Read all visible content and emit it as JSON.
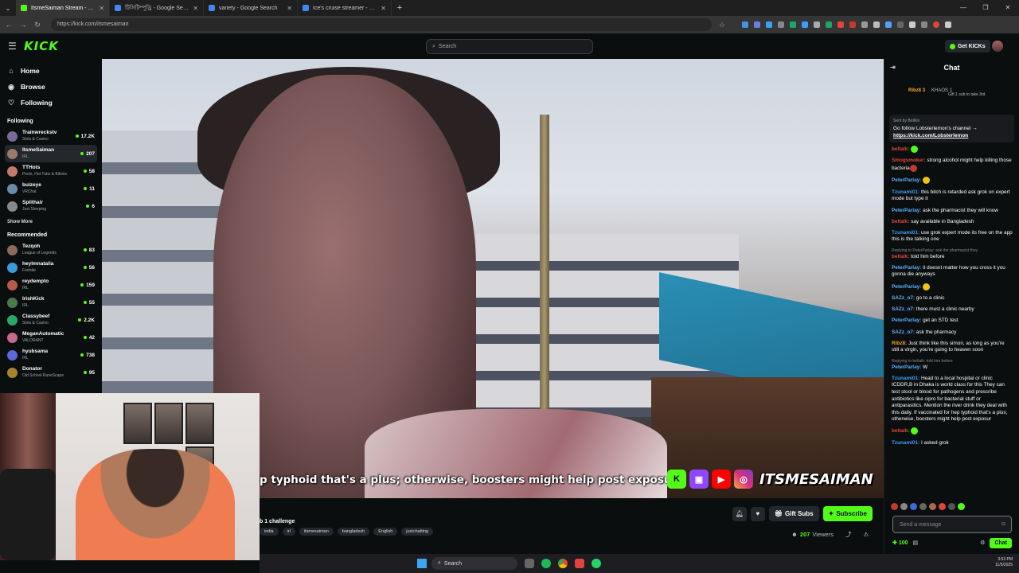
{
  "browser": {
    "tabs": [
      {
        "label": "ItsmeSaiman Stream - Wat",
        "color": "#53fc18",
        "active": true
      },
      {
        "label": "টিসিটিম্পুড্রি - Google Search",
        "color": "#4285f4",
        "active": false
      },
      {
        "label": "variety - Google Search",
        "color": "#4285f4",
        "active": false
      },
      {
        "label": "Ice's cruise streamer - Google S",
        "color": "#4285f4",
        "active": false
      }
    ],
    "url": "https://kick.com/itsmesaiman"
  },
  "header": {
    "logo": "KICK",
    "search_placeholder": "Search",
    "get_kicks": "Get KICKs"
  },
  "sidebar": {
    "nav": [
      {
        "label": "Home",
        "icon": "home-icon",
        "glyph": "⌂"
      },
      {
        "label": "Browse",
        "icon": "browse-icon",
        "glyph": "◉"
      },
      {
        "label": "Following",
        "icon": "heart-icon",
        "glyph": "♡"
      }
    ],
    "following_title": "Following",
    "following": [
      {
        "name": "Trainwreckstv",
        "cat": "Slots & Casino",
        "viewers": "17.2K",
        "color": "#7a6a9a"
      },
      {
        "name": "ItsmeSaiman",
        "cat": "IRL",
        "viewers": "207",
        "color": "#9a7a6a"
      },
      {
        "name": "TTHots",
        "cat": "Pools, Hot Tubs & Bikinis",
        "viewers": "58",
        "color": "#c47a6a"
      },
      {
        "name": "buizeye",
        "cat": "VRChat",
        "viewers": "11",
        "color": "#6a8aa9"
      },
      {
        "name": "Splithair",
        "cat": "Just Sleeping",
        "viewers": "6",
        "color": "#888"
      }
    ],
    "show_more": "Show More",
    "recommended_title": "Recommended",
    "recommended": [
      {
        "name": "Tezqoh",
        "cat": "League of Legends",
        "viewers": "83",
        "color": "#8a6a5a"
      },
      {
        "name": "heylmnatalia",
        "cat": "Fortnite",
        "viewers": "56",
        "color": "#3a9adb"
      },
      {
        "name": "reydempto",
        "cat": "IRL",
        "viewers": "159",
        "color": "#b85a4a"
      },
      {
        "name": "IrishKick",
        "cat": "IRL",
        "viewers": "55",
        "color": "#4a7a4a"
      },
      {
        "name": "Classybeef",
        "cat": "Slots & Casino",
        "viewers": "2.2K",
        "color": "#2aa86a"
      },
      {
        "name": "MeganAutomatic",
        "cat": "VALORANT",
        "viewers": "42",
        "color": "#c86a8a"
      },
      {
        "name": "hyubsama",
        "cat": "IRL",
        "viewers": "738",
        "color": "#5a6ad8"
      },
      {
        "name": "Donator",
        "cat": "Old School RuneScape",
        "viewers": "95",
        "color": "#a8832a"
      }
    ]
  },
  "video": {
    "caption": "p typhoid that's a plus; otherwise, boosters might help post exposur",
    "handle": "ITSMESAIMAN"
  },
  "stream": {
    "title": "b 1 challenge",
    "tags": [
      "india",
      "irl",
      "itsmesaiman",
      "bangladesh",
      "English",
      "justchatting"
    ],
    "gift_subs": "Gift Subs",
    "subscribe": "Subscribe",
    "viewer_count": "207",
    "viewers_label": "Viewers"
  },
  "chat": {
    "title": "Chat",
    "gifter1": "Ribz8",
    "gifter1_count": "3",
    "gifter2": "KHAOS",
    "gifter2_count": "1",
    "gift_note": "Gift 1 sub to take 3rd",
    "pinned_by": "Sent by BotRix",
    "pinned_text": "Go follow Lobsterlemon's channel →",
    "pinned_link": "https://kick.com/Lobsterlemon",
    "messages": [
      {
        "user": "beltalk:",
        "color": "#e0443a",
        "text": "",
        "emote": "#53fc18"
      },
      {
        "user": "Smogsmoker:",
        "color": "#e0443a",
        "text": "strong alcohol might help killing those bacteria",
        "emote": "#c0392b"
      },
      {
        "user": "PeterParlay:",
        "color": "#5ab0ff",
        "text": "",
        "emote": "#f1c40f"
      },
      {
        "user": "Tzunami01:",
        "color": "#3aa0ff",
        "text": "this bitch is retarded ask grok on expert mode but type it"
      },
      {
        "user": "PeterParlay:",
        "color": "#5ab0ff",
        "text": "ask the pharmacist they will know"
      },
      {
        "user": "beltalk:",
        "color": "#e0443a",
        "text": "say available in Bangladesh"
      },
      {
        "user": "Tzunami01:",
        "color": "#3aa0ff",
        "text": "use grok expert mode its free on the app this is the talking one"
      },
      {
        "user": "beltalk:",
        "color": "#e0443a",
        "text": "told him before",
        "reply": "Replying to PeterParlay: ask the pharmacist they"
      },
      {
        "user": "PeterParlay:",
        "color": "#5ab0ff",
        "text": "it doesnt matter how you cross it you gonna die anyways"
      },
      {
        "user": "PeterParlay:",
        "color": "#5ab0ff",
        "text": "",
        "emote": "#f1c40f"
      },
      {
        "user": "SAZz_o7:",
        "color": "#6ab0ff",
        "text": "go to a clinic"
      },
      {
        "user": "SAZz_o7:",
        "color": "#6ab0ff",
        "text": "there must a clinic nearby"
      },
      {
        "user": "PeterParlay:",
        "color": "#5ab0ff",
        "text": "get an STD test"
      },
      {
        "user": "SAZz_o7:",
        "color": "#6ab0ff",
        "text": "ask the pharmacy"
      },
      {
        "user": "Ribz8:",
        "color": "#f5a623",
        "text": "Just think like this simon, as long as you're still a virgin, you're going to heaven soon"
      },
      {
        "user": "PeterParlay:",
        "color": "#5ab0ff",
        "text": "W",
        "reply": "Replying to beltalk: told him before"
      },
      {
        "user": "Tzunami01:",
        "color": "#3aa0ff",
        "text": "Head to a local hospital or clinic ICDDR,B in Dhaka is world class for this They can test stool or blood for pathogens and prescribe antibiotics like cipro for bacterial stuff or antiparasitics. Mention the river drink they deal with this daily. If vaccinated for hep typhoid that's a plus; otherwise, boosters might help post exposur"
      },
      {
        "user": "beltalk:",
        "color": "#e0443a",
        "text": "",
        "emote": "#53fc18"
      },
      {
        "user": "Tzunami01:",
        "color": "#3aa0ff",
        "text": "I asked grok"
      }
    ],
    "input_placeholder": "Send a message",
    "points": "100",
    "send_label": "Chat"
  },
  "taskbar": {
    "search": "Search",
    "time": "3:53 PM",
    "date": "11/5/2025"
  }
}
